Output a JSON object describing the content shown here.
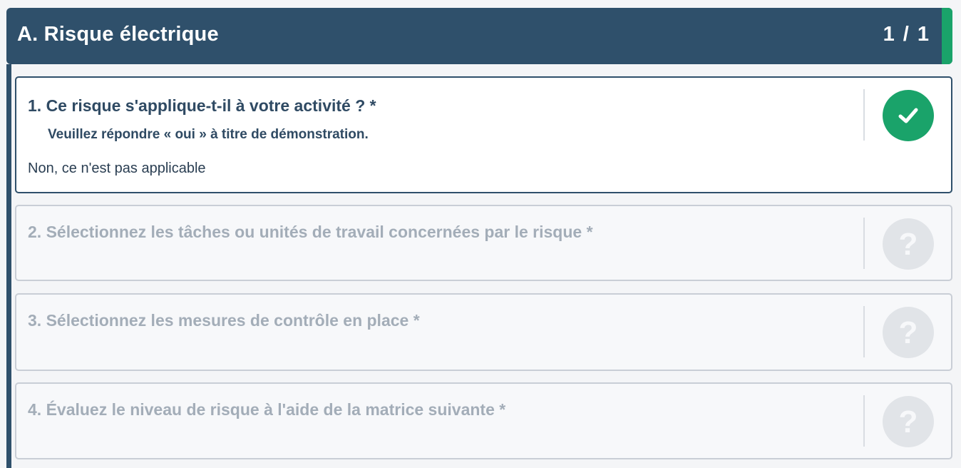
{
  "section": {
    "title": "A. Risque électrique",
    "counter": "1 / 1"
  },
  "questions": [
    {
      "title": "1. Ce risque s'applique-t-il à votre activité ? *",
      "hint": "Veuillez répondre « oui » à titre de démonstration.",
      "answer": "Non, ce n'est pas applicable",
      "status_icon": "check-icon"
    },
    {
      "title": "2. Sélectionnez les tâches ou unités de travail concernées par le risque *",
      "status_icon": "question-icon"
    },
    {
      "title": "3. Sélectionnez les mesures de contrôle en place *",
      "status_icon": "question-icon"
    },
    {
      "title": "4. Évaluez le niveau de risque à l'aide de la matrice suivante *",
      "status_icon": "question-icon"
    }
  ],
  "colors": {
    "header_bg": "#2f506b",
    "accent_green": "#1aa36a",
    "pending_text": "#a3adb8",
    "pending_icon_bg": "#e1e4e8"
  }
}
